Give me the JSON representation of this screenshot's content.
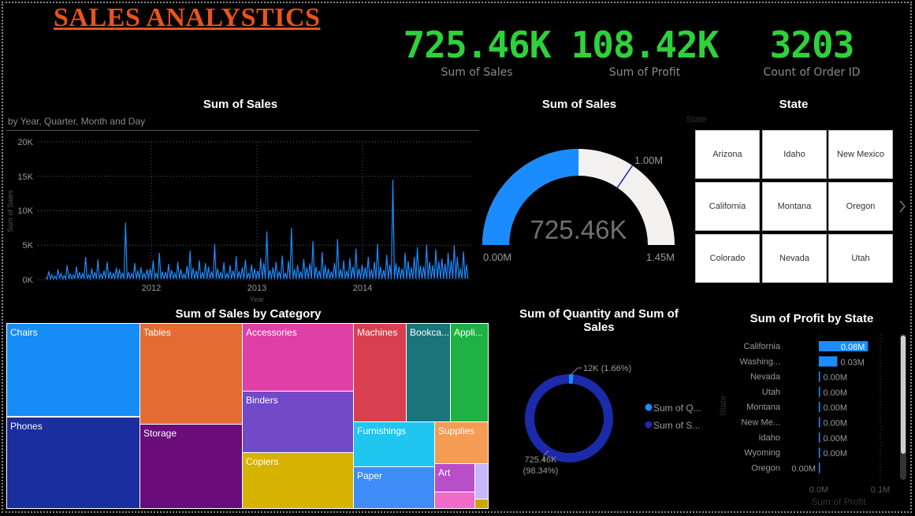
{
  "title": "SALES ANALYSTICS",
  "kpis": [
    {
      "value": "725.46K",
      "label": "Sum of Sales"
    },
    {
      "value": "108.42K",
      "label": "Sum of Profit"
    },
    {
      "value": "3203",
      "label": "Count of Order ID"
    }
  ],
  "line_chart": {
    "title": "Sum of Sales",
    "subtitle": "by Year, Quarter, Month and Day",
    "xlabel": "Year",
    "ylabel": "Sum of Sales",
    "y_ticks": [
      "0K",
      "5K",
      "10K",
      "15K",
      "20K"
    ],
    "x_ticks": [
      "2012",
      "2013",
      "2014"
    ],
    "color": "#1a8cff"
  },
  "gauge": {
    "title": "Sum of Sales",
    "value_label": "725.46K",
    "min_label": "0.00M",
    "max_label": "1.45M",
    "target_label": "1.00M",
    "value": 725460,
    "min": 0,
    "max": 1450000,
    "target": 1000000,
    "fill_color": "#1a8cff",
    "track_color": "#f2f1ef"
  },
  "slicer": {
    "title": "State",
    "header": "State",
    "items": [
      "Arizona",
      "Idaho",
      "New Mexico",
      "California",
      "Montana",
      "Oregon",
      "Colorado",
      "Nevada",
      "Utah"
    ],
    "next_icon": "chevron-right-icon"
  },
  "treemap": {
    "title": "Sum of Sales by Category",
    "labels": {
      "chairs": "Chairs",
      "phones": "Phones",
      "tables": "Tables",
      "storage": "Storage",
      "accessories": "Accessories",
      "binders": "Binders",
      "copiers": "Copiers",
      "machines": "Machines",
      "bookcases": "Bookca...",
      "appliances": "Appli...",
      "furnishings": "Furnishings",
      "supplies": "Supplies",
      "paper": "Paper",
      "art": "Art"
    },
    "colors": {
      "chairs": "#168cf7",
      "phones": "#1a2e9e",
      "tables": "#e36c33",
      "storage": "#6a0d7a",
      "accessories": "#e03fa6",
      "binders": "#7249c6",
      "copiers": "#d6b300",
      "machines": "#d8404f",
      "bookcases": "#1a757a",
      "appliances": "#1fb143",
      "furnishings": "#1ec6f0",
      "supplies": "#f59b54",
      "paper": "#3d8cf7",
      "art": "#b94ec9",
      "small1": "#c5b8ff",
      "small2": "#f06ac9",
      "small3": "#c9a600"
    }
  },
  "donut": {
    "title": "Sum of Quantity and Sum of Sales",
    "legend": [
      "Sum of Q...",
      "Sum of S..."
    ],
    "label_small": "12K (1.66%)",
    "label_large_value": "725.46K",
    "label_large_pct": "(98.34%)",
    "colors": [
      "#1a8cff",
      "#1a2aa8"
    ]
  },
  "bar_chart": {
    "title": "Sum of Profit by State",
    "xlabel": "Sum of Profit",
    "ylabel": "State",
    "x_ticks": [
      "0.0M",
      "0.1M"
    ],
    "bar_color": "#1a8cff"
  },
  "chart_data": [
    {
      "type": "line",
      "title": "Sum of Sales",
      "subtitle": "by Year, Quarter, Month and Day",
      "xlabel": "Year",
      "ylabel": "Sum of Sales",
      "x_ticks": [
        "2012",
        "2013",
        "2014"
      ],
      "ylim": [
        0,
        20000
      ],
      "y_ticks": [
        0,
        5000,
        10000,
        15000,
        20000
      ],
      "grid": true,
      "series": [
        {
          "values": [
            300,
            1200,
            700,
            500,
            1500,
            900,
            600,
            2100,
            800,
            700,
            1900,
            1100,
            900,
            3300,
            700,
            1600,
            1100,
            2900,
            800,
            1300,
            2600,
            1200,
            900,
            1700,
            1500,
            1000,
            8300,
            1100,
            900,
            2400,
            1300,
            1800,
            900,
            1500,
            1600,
            2800,
            1000,
            3900,
            1200,
            1100,
            2300,
            1400,
            900,
            2600,
            1500,
            800,
            2000,
            4200,
            1700,
            1300,
            2800,
            1100,
            2400,
            1900,
            1200,
            5200,
            1600,
            1100,
            2500,
            900,
            2100,
            1300,
            3400,
            1200,
            1800,
            2900,
            1000,
            2200,
            1600,
            1300,
            3100,
            2400,
            7000,
            1400,
            1800,
            2600,
            1200,
            3500,
            1000,
            2700,
            7500,
            1500,
            2100,
            1200,
            3000,
            1800,
            2400,
            5600,
            1900,
            1300,
            4000,
            2100,
            1600,
            1200,
            2400,
            5900,
            1500,
            2800,
            1300,
            3100,
            1900,
            4500,
            1600,
            2200,
            1800,
            3300,
            1500,
            2600,
            5200,
            1900,
            1400,
            3600,
            2200,
            14500,
            2400,
            1900,
            1600,
            3900,
            2700,
            1800,
            3300,
            4700,
            2000,
            1900,
            5100,
            2600,
            2100,
            4400,
            2600,
            3100,
            2300,
            3900,
            2800,
            5000,
            3300,
            1600,
            4100,
            2200
          ]
        }
      ]
    },
    {
      "type": "gauge",
      "title": "Sum of Sales",
      "value": 725460,
      "min": 0,
      "max": 1450000,
      "target": 1000000
    },
    {
      "type": "pie",
      "title": "Sum of Quantity and Sum of Sales",
      "categories": [
        "Sum of Quantity",
        "Sum of Sales"
      ],
      "values": [
        12000,
        725460
      ],
      "percent": [
        1.66,
        98.34
      ]
    },
    {
      "type": "bar",
      "title": "Sum of Profit by State",
      "xlabel": "Sum of Profit",
      "ylabel": "State",
      "categories": [
        "California",
        "Washing...",
        "Nevada",
        "Utah",
        "Montana",
        "New Me...",
        "Idaho",
        "Wyoming",
        "Oregon"
      ],
      "values": [
        0.08,
        0.03,
        0.0,
        0.0,
        0.0,
        0.0,
        0.0,
        0.0,
        0.0
      ],
      "data_labels": [
        "0.08M",
        "0.03M",
        "0.00M",
        "0.00M",
        "0.00M",
        "0.00M",
        "0.00M",
        "0.00M",
        "0.00M"
      ],
      "units": "M",
      "xlim": [
        0,
        0.13
      ]
    }
  ]
}
